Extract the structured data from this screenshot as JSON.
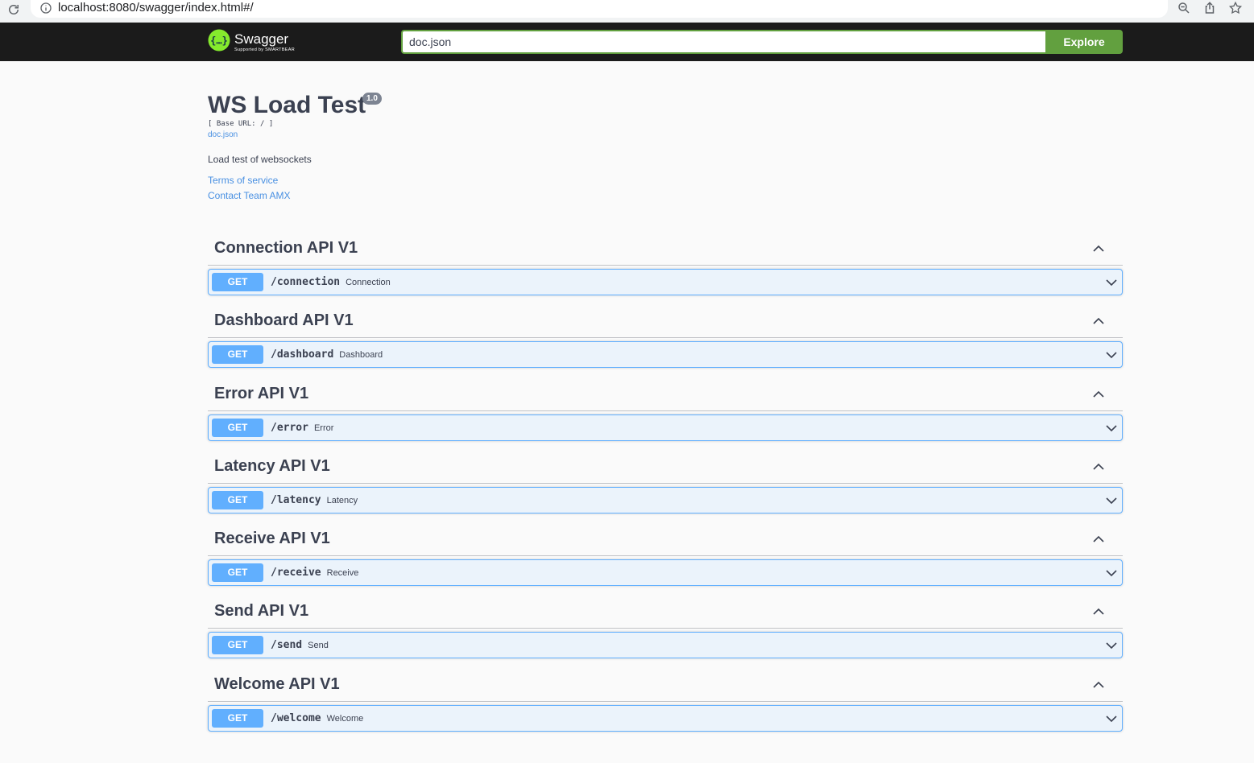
{
  "browser": {
    "url": "localhost:8080/swagger/index.html#/"
  },
  "topbar": {
    "logo_text": "Swagger",
    "logo_sub": "Supported by SMARTBEAR",
    "search_value": "doc.json",
    "explore_label": "Explore"
  },
  "info": {
    "title": "WS Load Test",
    "version": "1.0",
    "base_url": "[ Base URL: / ]",
    "doc_link": "doc.json",
    "description": "Load test of websockets",
    "terms": "Terms of service",
    "contact": "Contact Team AMX"
  },
  "colors": {
    "get": "#61affe",
    "explore": "#62a03f",
    "link": "#4990e2"
  },
  "sections": [
    {
      "title": "Connection API V1",
      "method": "GET",
      "path": "/connection",
      "summary": "Connection"
    },
    {
      "title": "Dashboard API V1",
      "method": "GET",
      "path": "/dashboard",
      "summary": "Dashboard"
    },
    {
      "title": "Error API V1",
      "method": "GET",
      "path": "/error",
      "summary": "Error"
    },
    {
      "title": "Latency API V1",
      "method": "GET",
      "path": "/latency",
      "summary": "Latency"
    },
    {
      "title": "Receive API V1",
      "method": "GET",
      "path": "/receive",
      "summary": "Receive"
    },
    {
      "title": "Send API V1",
      "method": "GET",
      "path": "/send",
      "summary": "Send"
    },
    {
      "title": "Welcome API V1",
      "method": "GET",
      "path": "/welcome",
      "summary": "Welcome"
    }
  ]
}
